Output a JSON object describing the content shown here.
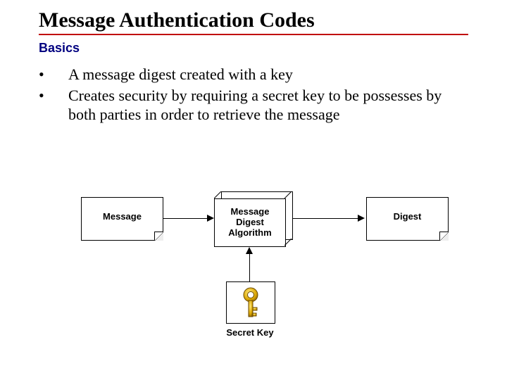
{
  "title": "Message Authentication Codes",
  "subtitle": "Basics",
  "bullets": [
    "A message digest created with a key",
    "Creates security by requiring a secret key to be possesses by both parties in order to retrieve the message"
  ],
  "diagram": {
    "message_box": "Message",
    "algorithm_box": "Message\nDigest\nAlgorithm",
    "digest_box": "Digest",
    "secret_key": "Secret Key"
  }
}
